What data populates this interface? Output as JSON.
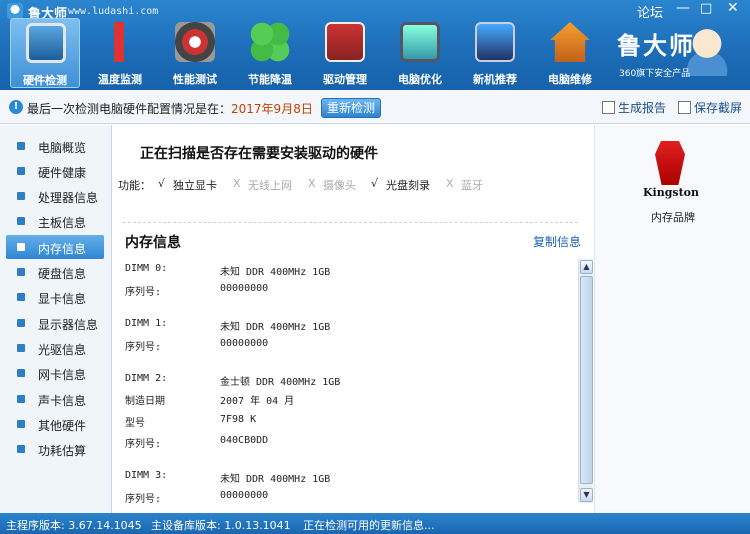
{
  "window": {
    "title": "鲁大师",
    "url": "www.ludashi.com",
    "forum_label": "论坛",
    "min_glyph": "—",
    "max_glyph": "□",
    "close_glyph": "✕"
  },
  "tabs": [
    {
      "label": "硬件检测",
      "icon": "monitor-magnifier-icon",
      "active": true
    },
    {
      "label": "温度监测",
      "icon": "thermometer-icon",
      "active": false
    },
    {
      "label": "性能测试",
      "icon": "gauge-icon",
      "active": false
    },
    {
      "label": "节能降温",
      "icon": "clover-icon",
      "active": false
    },
    {
      "label": "驱动管理",
      "icon": "toolbox-icon",
      "active": false
    },
    {
      "label": "电脑优化",
      "icon": "screen-brush-icon",
      "active": false
    },
    {
      "label": "新机推荐",
      "icon": "computer-ribbon-icon",
      "active": false
    },
    {
      "label": "电脑维修",
      "icon": "house-icon",
      "active": false
    }
  ],
  "brand": {
    "name": "鲁大师",
    "tagline": "360旗下安全产品"
  },
  "infobar": {
    "text": "最后一次检测电脑硬件配置情况是在：",
    "date": "2017年9月8日",
    "recheck_label": "重新检测",
    "report_label": "生成报告",
    "screenshot_label": "保存截屏"
  },
  "sidebar": {
    "items": [
      {
        "label": "电脑概览",
        "active": false
      },
      {
        "label": "硬件健康",
        "active": false
      },
      {
        "label": "处理器信息",
        "active": false
      },
      {
        "label": "主板信息",
        "active": false
      },
      {
        "label": "内存信息",
        "active": true
      },
      {
        "label": "硬盘信息",
        "active": false
      },
      {
        "label": "显卡信息",
        "active": false
      },
      {
        "label": "显示器信息",
        "active": false
      },
      {
        "label": "光驱信息",
        "active": false
      },
      {
        "label": "网卡信息",
        "active": false
      },
      {
        "label": "声卡信息",
        "active": false
      },
      {
        "label": "其他硬件",
        "active": false
      },
      {
        "label": "功耗估算",
        "active": false
      }
    ]
  },
  "main": {
    "scan_title": "正在扫描是否存在需要安装驱动的硬件",
    "features_label": "功能：",
    "features": [
      {
        "mark": "√",
        "label": "独立显卡",
        "on": true
      },
      {
        "mark": "X",
        "label": "无线上网",
        "on": false
      },
      {
        "mark": "X",
        "label": "摄像头",
        "on": false
      },
      {
        "mark": "√",
        "label": "光盘刻录",
        "on": true
      },
      {
        "mark": "X",
        "label": "蓝牙",
        "on": false
      }
    ],
    "mem_title": "内存信息",
    "copy_label": "复制信息",
    "rows": [
      {
        "k": "DIMM 0:",
        "v": "未知 DDR 400MHz 1GB"
      },
      {
        "k": "序列号:",
        "v": "00000000"
      },
      {
        "k": "DIMM 1:",
        "v": "未知 DDR 400MHz 1GB"
      },
      {
        "k": "序列号:",
        "v": "00000000"
      },
      {
        "k": "DIMM 2:",
        "v": "金士顿 DDR 400MHz 1GB"
      },
      {
        "k": "制造日期",
        "v": "2007 年 04 月"
      },
      {
        "k": "型号",
        "v": "7F98 K"
      },
      {
        "k": "序列号:",
        "v": "040CB0DD"
      },
      {
        "k": "DIMM 3:",
        "v": "未知 DDR 400MHz 1GB"
      },
      {
        "k": "序列号:",
        "v": "00000000"
      }
    ]
  },
  "right_panel": {
    "logo_text": "Kingston",
    "brand_label": "内存品牌"
  },
  "status_bar": {
    "main_version": "主程序版本: 3.67.14.1045",
    "db_version": "主设备库版本: 1.0.13.1041",
    "message": "正在检测可用的更新信息..."
  }
}
